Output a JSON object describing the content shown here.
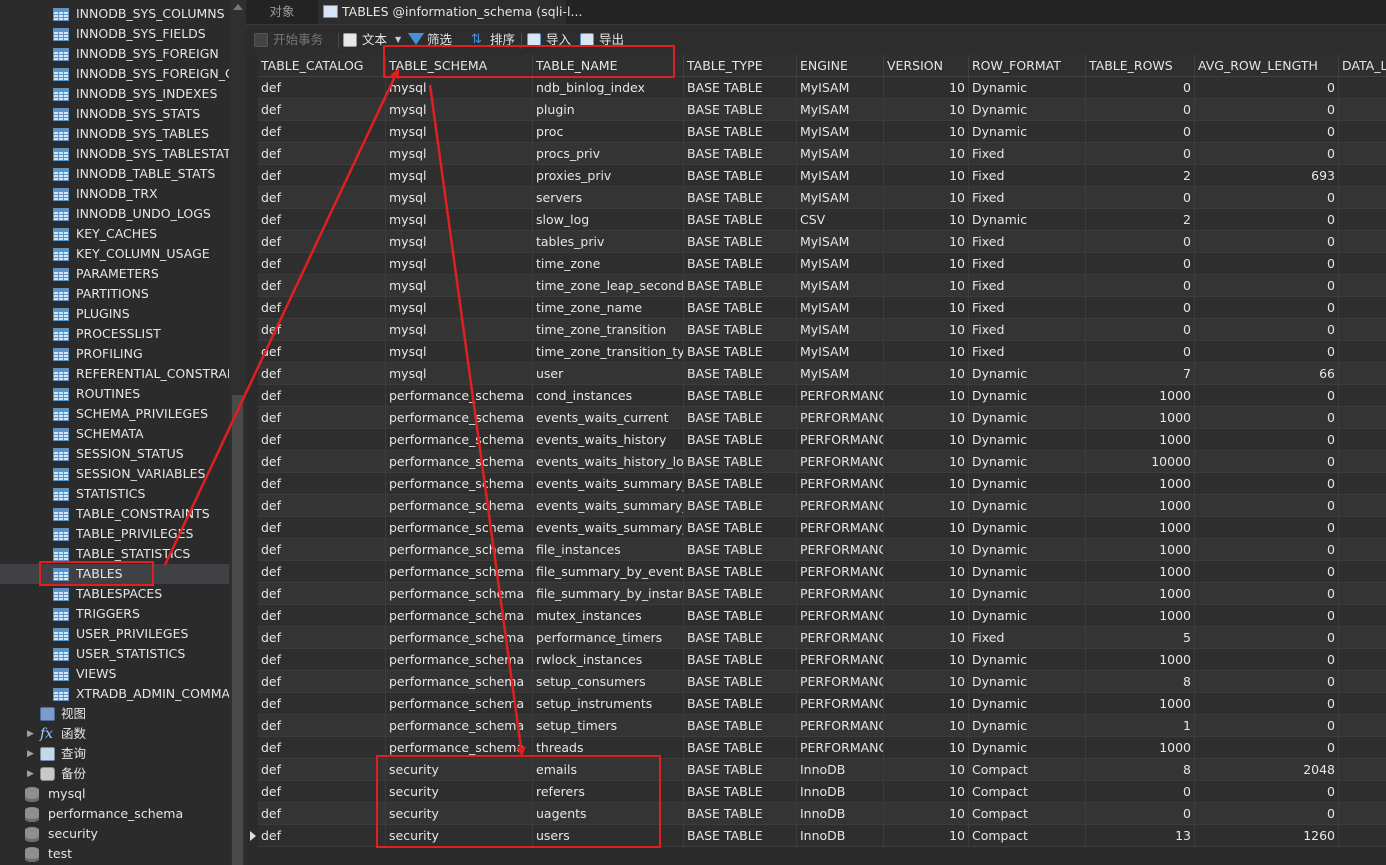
{
  "sidebar": {
    "tables": [
      "INNODB_SYS_COLUMNS",
      "INNODB_SYS_FIELDS",
      "INNODB_SYS_FOREIGN",
      "INNODB_SYS_FOREIGN_CC",
      "INNODB_SYS_INDEXES",
      "INNODB_SYS_STATS",
      "INNODB_SYS_TABLES",
      "INNODB_SYS_TABLESTATS",
      "INNODB_TABLE_STATS",
      "INNODB_TRX",
      "INNODB_UNDO_LOGS",
      "KEY_CACHES",
      "KEY_COLUMN_USAGE",
      "PARAMETERS",
      "PARTITIONS",
      "PLUGINS",
      "PROCESSLIST",
      "PROFILING",
      "REFERENTIAL_CONSTRAINTS",
      "ROUTINES",
      "SCHEMA_PRIVILEGES",
      "SCHEMATA",
      "SESSION_STATUS",
      "SESSION_VARIABLES",
      "STATISTICS",
      "TABLE_CONSTRAINTS",
      "TABLE_PRIVILEGES",
      "TABLE_STATISTICS",
      "TABLES",
      "TABLESPACES",
      "TRIGGERS",
      "USER_PRIVILEGES",
      "USER_STATISTICS",
      "VIEWS",
      "XTRADB_ADMIN_COMMAND"
    ],
    "selected_table": "TABLES",
    "groups": [
      {
        "label": "视图",
        "icon": "view-icon"
      },
      {
        "label": "函数",
        "icon": "function-icon"
      },
      {
        "label": "查询",
        "icon": "query-icon"
      },
      {
        "label": "备份",
        "icon": "backup-icon"
      }
    ],
    "databases": [
      "mysql",
      "performance_schema",
      "security",
      "test"
    ]
  },
  "tabs": {
    "objects": "对象",
    "active": "TABLES @information_schema (sqli-l..."
  },
  "toolbar": {
    "begin_transaction": "开始事务",
    "text": "文本",
    "filter": "筛选",
    "sort": "排序",
    "import": "导入",
    "export": "导出"
  },
  "grid": {
    "columns": [
      "TABLE_CATALOG",
      "TABLE_SCHEMA",
      "TABLE_NAME",
      "TABLE_TYPE",
      "ENGINE",
      "VERSION",
      "ROW_FORMAT",
      "TABLE_ROWS",
      "AVG_ROW_LENGTH",
      "DATA_LE"
    ],
    "rows": [
      [
        "def",
        "mysql",
        "ndb_binlog_index",
        "BASE TABLE",
        "MyISAM",
        "10",
        "Dynamic",
        "0",
        "0"
      ],
      [
        "def",
        "mysql",
        "plugin",
        "BASE TABLE",
        "MyISAM",
        "10",
        "Dynamic",
        "0",
        "0"
      ],
      [
        "def",
        "mysql",
        "proc",
        "BASE TABLE",
        "MyISAM",
        "10",
        "Dynamic",
        "0",
        "0"
      ],
      [
        "def",
        "mysql",
        "procs_priv",
        "BASE TABLE",
        "MyISAM",
        "10",
        "Fixed",
        "0",
        "0"
      ],
      [
        "def",
        "mysql",
        "proxies_priv",
        "BASE TABLE",
        "MyISAM",
        "10",
        "Fixed",
        "2",
        "693"
      ],
      [
        "def",
        "mysql",
        "servers",
        "BASE TABLE",
        "MyISAM",
        "10",
        "Fixed",
        "0",
        "0"
      ],
      [
        "def",
        "mysql",
        "slow_log",
        "BASE TABLE",
        "CSV",
        "10",
        "Dynamic",
        "2",
        "0"
      ],
      [
        "def",
        "mysql",
        "tables_priv",
        "BASE TABLE",
        "MyISAM",
        "10",
        "Fixed",
        "0",
        "0"
      ],
      [
        "def",
        "mysql",
        "time_zone",
        "BASE TABLE",
        "MyISAM",
        "10",
        "Fixed",
        "0",
        "0"
      ],
      [
        "def",
        "mysql",
        "time_zone_leap_second",
        "BASE TABLE",
        "MyISAM",
        "10",
        "Fixed",
        "0",
        "0"
      ],
      [
        "def",
        "mysql",
        "time_zone_name",
        "BASE TABLE",
        "MyISAM",
        "10",
        "Fixed",
        "0",
        "0"
      ],
      [
        "def",
        "mysql",
        "time_zone_transition",
        "BASE TABLE",
        "MyISAM",
        "10",
        "Fixed",
        "0",
        "0"
      ],
      [
        "def",
        "mysql",
        "time_zone_transition_type",
        "BASE TABLE",
        "MyISAM",
        "10",
        "Fixed",
        "0",
        "0"
      ],
      [
        "def",
        "mysql",
        "user",
        "BASE TABLE",
        "MyISAM",
        "10",
        "Dynamic",
        "7",
        "66"
      ],
      [
        "def",
        "performance_schema",
        "cond_instances",
        "BASE TABLE",
        "PERFORMANCE",
        "10",
        "Dynamic",
        "1000",
        "0"
      ],
      [
        "def",
        "performance_schema",
        "events_waits_current",
        "BASE TABLE",
        "PERFORMANCE",
        "10",
        "Dynamic",
        "1000",
        "0"
      ],
      [
        "def",
        "performance_schema",
        "events_waits_history",
        "BASE TABLE",
        "PERFORMANCE",
        "10",
        "Dynamic",
        "1000",
        "0"
      ],
      [
        "def",
        "performance_schema",
        "events_waits_history_long",
        "BASE TABLE",
        "PERFORMANCE",
        "10",
        "Dynamic",
        "10000",
        "0"
      ],
      [
        "def",
        "performance_schema",
        "events_waits_summary_by",
        "BASE TABLE",
        "PERFORMANCE",
        "10",
        "Dynamic",
        "1000",
        "0"
      ],
      [
        "def",
        "performance_schema",
        "events_waits_summary_by",
        "BASE TABLE",
        "PERFORMANCE",
        "10",
        "Dynamic",
        "1000",
        "0"
      ],
      [
        "def",
        "performance_schema",
        "events_waits_summary_glo",
        "BASE TABLE",
        "PERFORMANCE",
        "10",
        "Dynamic",
        "1000",
        "0"
      ],
      [
        "def",
        "performance_schema",
        "file_instances",
        "BASE TABLE",
        "PERFORMANCE",
        "10",
        "Dynamic",
        "1000",
        "0"
      ],
      [
        "def",
        "performance_schema",
        "file_summary_by_event_na",
        "BASE TABLE",
        "PERFORMANCE",
        "10",
        "Dynamic",
        "1000",
        "0"
      ],
      [
        "def",
        "performance_schema",
        "file_summary_by_instance",
        "BASE TABLE",
        "PERFORMANCE",
        "10",
        "Dynamic",
        "1000",
        "0"
      ],
      [
        "def",
        "performance_schema",
        "mutex_instances",
        "BASE TABLE",
        "PERFORMANCE",
        "10",
        "Dynamic",
        "1000",
        "0"
      ],
      [
        "def",
        "performance_schema",
        "performance_timers",
        "BASE TABLE",
        "PERFORMANCE",
        "10",
        "Fixed",
        "5",
        "0"
      ],
      [
        "def",
        "performance_schema",
        "rwlock_instances",
        "BASE TABLE",
        "PERFORMANCE",
        "10",
        "Dynamic",
        "1000",
        "0"
      ],
      [
        "def",
        "performance_schema",
        "setup_consumers",
        "BASE TABLE",
        "PERFORMANCE",
        "10",
        "Dynamic",
        "8",
        "0"
      ],
      [
        "def",
        "performance_schema",
        "setup_instruments",
        "BASE TABLE",
        "PERFORMANCE",
        "10",
        "Dynamic",
        "1000",
        "0"
      ],
      [
        "def",
        "performance_schema",
        "setup_timers",
        "BASE TABLE",
        "PERFORMANCE",
        "10",
        "Dynamic",
        "1",
        "0"
      ],
      [
        "def",
        "performance_schema",
        "threads",
        "BASE TABLE",
        "PERFORMANCE",
        "10",
        "Dynamic",
        "1000",
        "0"
      ],
      [
        "def",
        "security",
        "emails",
        "BASE TABLE",
        "InnoDB",
        "10",
        "Compact",
        "8",
        "2048"
      ],
      [
        "def",
        "security",
        "referers",
        "BASE TABLE",
        "InnoDB",
        "10",
        "Compact",
        "0",
        "0"
      ],
      [
        "def",
        "security",
        "uagents",
        "BASE TABLE",
        "InnoDB",
        "10",
        "Compact",
        "0",
        "0"
      ],
      [
        "def",
        "security",
        "users",
        "BASE TABLE",
        "InnoDB",
        "10",
        "Compact",
        "13",
        "1260"
      ]
    ]
  },
  "colors": {
    "annotation": "#e02020",
    "background": "#2b2b2b",
    "accent": "#4a90d9"
  }
}
